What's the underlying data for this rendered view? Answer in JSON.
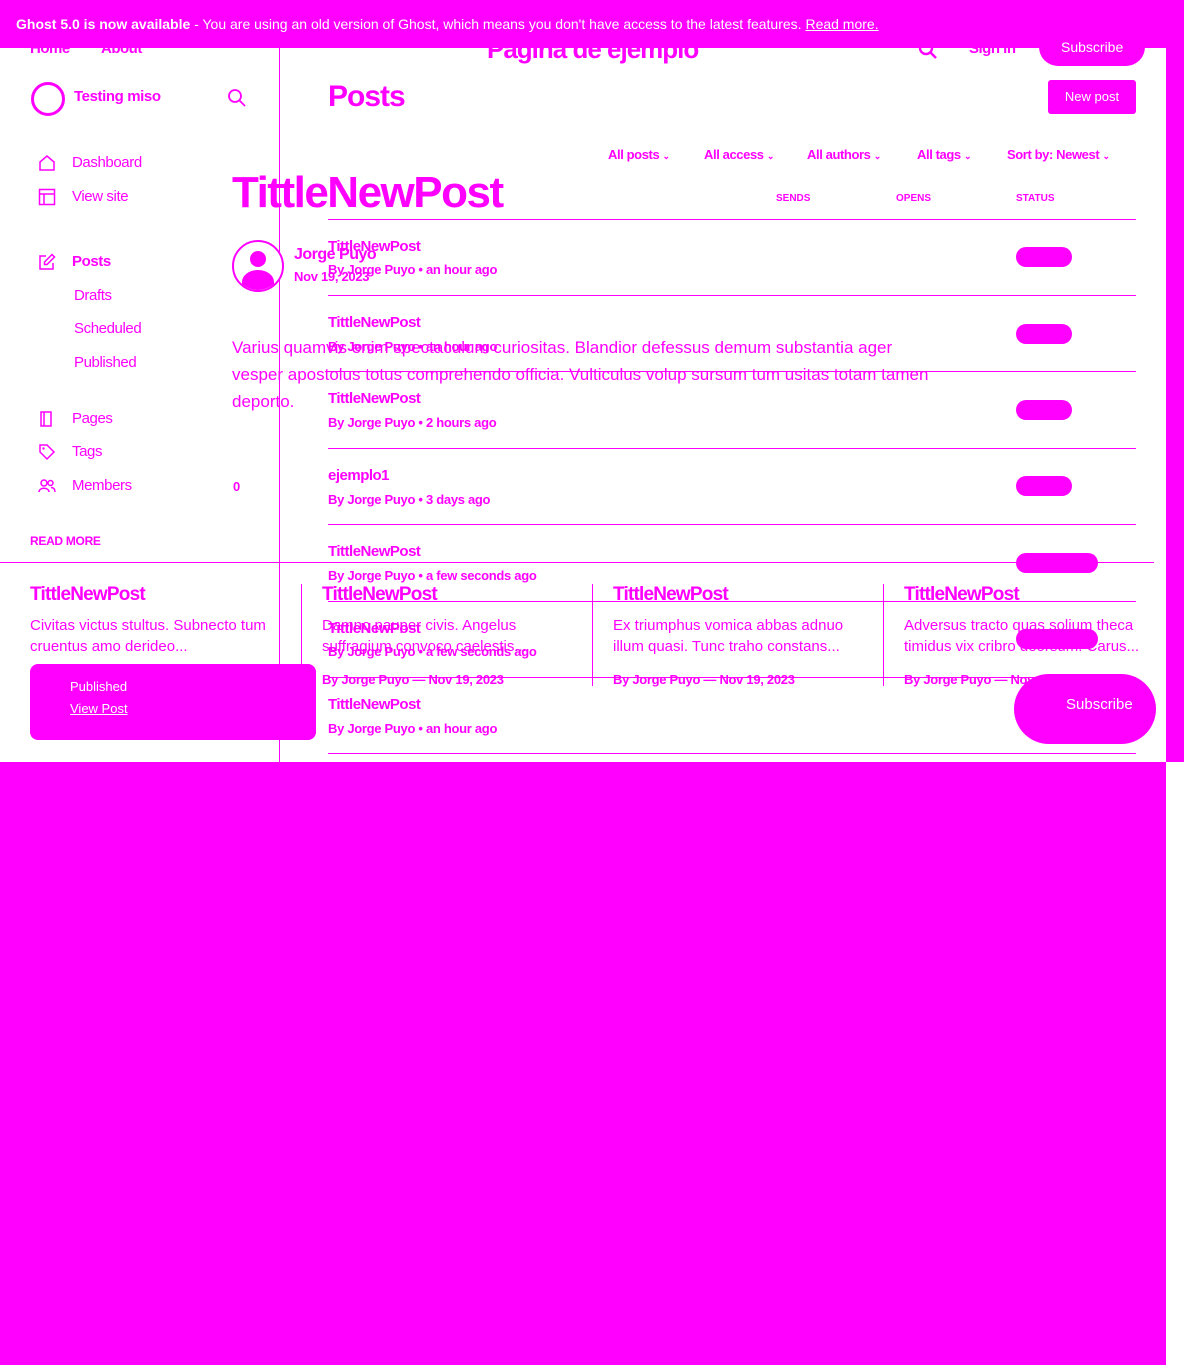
{
  "banner": {
    "title": "Ghost 5.0 is now available",
    "message": " - You are using an old version of Ghost, which means you don't have access to the latest features. ",
    "link": "Read more."
  },
  "site": {
    "nav": [
      "Home",
      "About"
    ],
    "title": "Pagina de ejemplo",
    "signin": "Sign in",
    "subscribe": "Subscribe"
  },
  "sidebar": {
    "brand": "Testing miso",
    "items": [
      {
        "label": "Dashboard",
        "icon": "home-icon"
      },
      {
        "label": "View site",
        "icon": "layout-icon"
      },
      {
        "label": "Posts",
        "icon": "edit-icon"
      },
      {
        "label": "Drafts"
      },
      {
        "label": "Scheduled"
      },
      {
        "label": "Published"
      },
      {
        "label": "Pages",
        "icon": "page-icon"
      },
      {
        "label": "Tags",
        "icon": "tag-icon"
      },
      {
        "label": "Members",
        "icon": "members-icon",
        "count": "0"
      }
    ],
    "read_more": "READ MORE"
  },
  "posts": {
    "title": "Posts",
    "new_post": "New post",
    "filters": [
      "All posts",
      "All access",
      "All authors",
      "All tags",
      "Sort by: Newest"
    ],
    "columns": [
      "SENDS",
      "OPENS",
      "STATUS"
    ],
    "rows": [
      {
        "title": "TittleNewPost",
        "meta": "By Jorge Puyo • an hour ago"
      },
      {
        "title": "TittleNewPost",
        "meta": "By Jorge Puyo • an hour ago"
      },
      {
        "title": "TittleNewPost",
        "meta": "By Jorge Puyo • 2 hours ago"
      },
      {
        "title": "ejemplo1",
        "meta": "By Jorge Puyo • 3 days ago"
      },
      {
        "title": "TittleNewPost",
        "meta": "By Jorge Puyo • a few seconds ago"
      },
      {
        "title": "TittleNewPost",
        "meta": "By Jorge Puyo • a few seconds ago"
      },
      {
        "title": "TittleNewPost",
        "meta": "By Jorge Puyo • an hour ago"
      }
    ]
  },
  "preview": {
    "title": "TittleNewPost",
    "author": "Jorge Puyo",
    "date": "Nov 19, 2023",
    "excerpt": "Varius quamvis enim spectaculum curiositas. Blandior defessus demum substantia ager vesper apostolus totus comprehendo officia. Vulticulus volup sursum tum usitas totam tamen deporto."
  },
  "cards": [
    {
      "title": "TittleNewPost",
      "text": "Civitas victus stultus. Subnecto tum cruentus amo derideo...",
      "meta": ""
    },
    {
      "title": "TittleNewPost",
      "text": "Damno pauper civis. Angelus suffragium convoco caelestis...",
      "meta": "By Jorge Puyo — Nov 19, 2023"
    },
    {
      "title": "TittleNewPost",
      "text": "Ex triumphus vomica abbas adnuo illum quasi. Tunc traho constans...",
      "meta": "By Jorge Puyo — Nov 19, 2023"
    },
    {
      "title": "TittleNewPost",
      "text": "Adversus tracto quas solium theca timidus vix cribro deorsum. Carus...",
      "meta": "By Jorge Puyo — Nov 19, 2023"
    }
  ],
  "toast": {
    "status": "Published",
    "link": "View Post"
  },
  "subscribe_button": "Subscribe"
}
